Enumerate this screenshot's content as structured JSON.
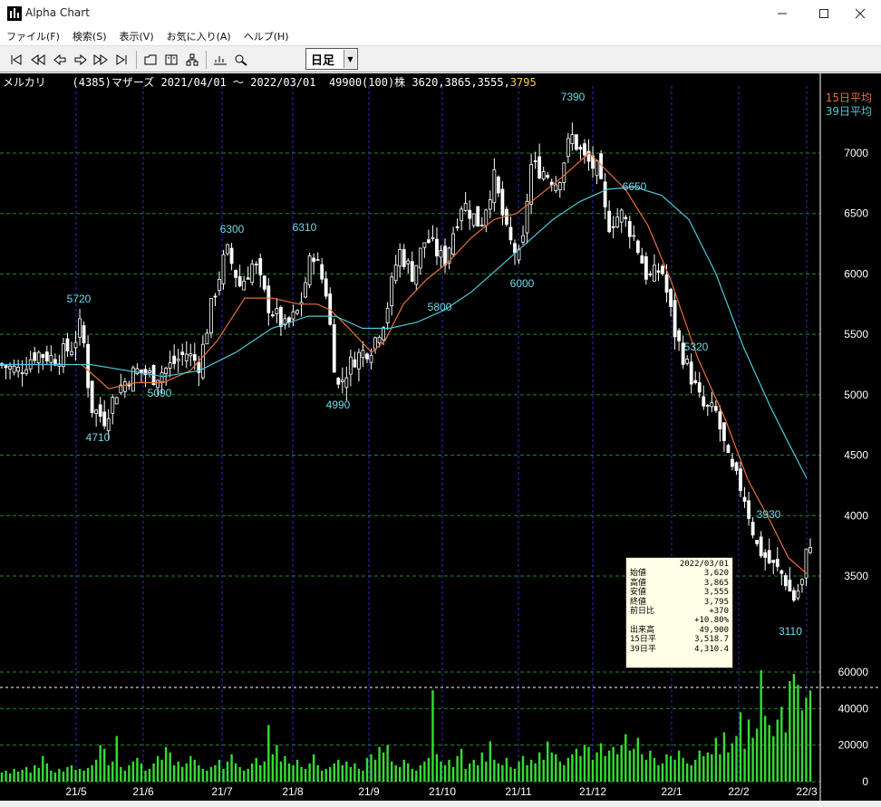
{
  "window": {
    "title": "Alpha Chart"
  },
  "menu": {
    "items": [
      "ファイル(F)",
      "検索(S)",
      "表示(V)",
      "お気に入り(A)",
      "ヘルプ(H)"
    ]
  },
  "toolbar": {
    "period": "日足"
  },
  "header": {
    "name": "メルカリ",
    "code": "(4385)マザーズ",
    "range": "2021/04/01 ～ 2022/03/01",
    "volume": "49900(100)株",
    "ohl": "3620,3865,3555,",
    "close": "3795"
  },
  "legend": {
    "ma15": "15日平均",
    "ma39": "39日平均"
  },
  "info": {
    "date": "2022/03/01",
    "rows": [
      {
        "label": "始値",
        "value": "3,620"
      },
      {
        "label": "高値",
        "value": "3,865"
      },
      {
        "label": "安値",
        "value": "3,555"
      },
      {
        "label": "終値",
        "value": "3,795"
      },
      {
        "label": "前日比",
        "value": "+370"
      },
      {
        "label": "",
        "value": "+10.80%"
      },
      {
        "label": "出来高",
        "value": "49,900"
      },
      {
        "label": "15日平",
        "value": "3,518.7"
      },
      {
        "label": "39日平",
        "value": "4,310.4"
      }
    ]
  },
  "colors": {
    "candle": "#ffffff",
    "ma15": "#e8703a",
    "ma39": "#4fc8d8",
    "volume": "#33dd33",
    "grid_price": "#1f8a1f",
    "grid_month": "#2c2cc8",
    "annotation": "#70d8ea"
  },
  "chart_data": {
    "type": "candlestick",
    "price_axis": {
      "ticks": [
        7000,
        6500,
        6000,
        5500,
        5000,
        4500,
        4000,
        3500
      ],
      "range": [
        3050,
        7500
      ]
    },
    "volume_axis": {
      "ticks": [
        60000,
        40000,
        20000,
        0
      ],
      "range": [
        0,
        60000
      ]
    },
    "x_labels": [
      "21/5",
      "21/6",
      "21/7",
      "21/8",
      "21/9",
      "21/10",
      "21/11",
      "21/12",
      "22/1",
      "22/2",
      "22/3"
    ],
    "annotations": [
      {
        "text": "5720",
        "value": 5720
      },
      {
        "text": "4710",
        "value": 4710
      },
      {
        "text": "5090",
        "value": 5090
      },
      {
        "text": "6300",
        "value": 6300
      },
      {
        "text": "6310",
        "value": 6310
      },
      {
        "text": "4990",
        "value": 4990
      },
      {
        "text": "5800",
        "value": 5800
      },
      {
        "text": "6000",
        "value": 6000
      },
      {
        "text": "7390",
        "value": 7390
      },
      {
        "text": "6650",
        "value": 6650
      },
      {
        "text": "5320",
        "value": 5320
      },
      {
        "text": "3930",
        "value": 3930
      },
      {
        "text": "3110",
        "value": 3110
      }
    ],
    "close_path": [
      [
        0,
        5250
      ],
      [
        20,
        5200
      ],
      [
        40,
        5350
      ],
      [
        60,
        5300
      ],
      [
        80,
        5400
      ],
      [
        90,
        5600
      ],
      [
        100,
        4900
      ],
      [
        115,
        4800
      ],
      [
        130,
        5050
      ],
      [
        150,
        5200
      ],
      [
        170,
        5150
      ],
      [
        190,
        5250
      ],
      [
        205,
        5350
      ],
      [
        220,
        5250
      ],
      [
        235,
        5800
      ],
      [
        250,
        6200
      ],
      [
        265,
        5900
      ],
      [
        280,
        6100
      ],
      [
        295,
        5750
      ],
      [
        315,
        5550
      ],
      [
        330,
        5700
      ],
      [
        345,
        6200
      ],
      [
        360,
        5850
      ],
      [
        372,
        5050
      ],
      [
        390,
        5300
      ],
      [
        410,
        5400
      ],
      [
        425,
        5650
      ],
      [
        440,
        6200
      ],
      [
        455,
        6000
      ],
      [
        470,
        6300
      ],
      [
        490,
        6100
      ],
      [
        510,
        6600
      ],
      [
        530,
        6400
      ],
      [
        545,
        6800
      ],
      [
        560,
        6300
      ],
      [
        575,
        6100
      ],
      [
        585,
        6900
      ],
      [
        600,
        6850
      ],
      [
        615,
        6750
      ],
      [
        630,
        7150
      ],
      [
        645,
        6950
      ],
      [
        660,
        6850
      ],
      [
        670,
        6400
      ],
      [
        685,
        6500
      ],
      [
        700,
        6300
      ],
      [
        715,
        5950
      ],
      [
        730,
        6050
      ],
      [
        745,
        5500
      ],
      [
        760,
        5200
      ],
      [
        775,
        4900
      ],
      [
        790,
        4850
      ],
      [
        805,
        4400
      ],
      [
        820,
        4200
      ],
      [
        835,
        3750
      ],
      [
        850,
        3600
      ],
      [
        865,
        3500
      ],
      [
        875,
        3300
      ],
      [
        885,
        3450
      ],
      [
        892,
        3795
      ]
    ],
    "ma15_path": [
      [
        90,
        5250
      ],
      [
        120,
        5050
      ],
      [
        150,
        5100
      ],
      [
        180,
        5100
      ],
      [
        210,
        5200
      ],
      [
        240,
        5450
      ],
      [
        270,
        5800
      ],
      [
        300,
        5800
      ],
      [
        330,
        5750
      ],
      [
        350,
        5750
      ],
      [
        365,
        5700
      ],
      [
        385,
        5550
      ],
      [
        410,
        5350
      ],
      [
        425,
        5450
      ],
      [
        445,
        5750
      ],
      [
        470,
        5950
      ],
      [
        495,
        6100
      ],
      [
        520,
        6300
      ],
      [
        545,
        6450
      ],
      [
        570,
        6500
      ],
      [
        595,
        6650
      ],
      [
        620,
        6800
      ],
      [
        650,
        7000
      ],
      [
        670,
        6850
      ],
      [
        690,
        6700
      ],
      [
        715,
        6400
      ],
      [
        740,
        5950
      ],
      [
        770,
        5300
      ],
      [
        800,
        4800
      ],
      [
        825,
        4300
      ],
      [
        850,
        3950
      ],
      [
        870,
        3650
      ],
      [
        890,
        3520
      ]
    ],
    "ma39_path": [
      [
        0,
        5250
      ],
      [
        60,
        5250
      ],
      [
        100,
        5250
      ],
      [
        140,
        5200
      ],
      [
        180,
        5150
      ],
      [
        220,
        5200
      ],
      [
        260,
        5350
      ],
      [
        300,
        5550
      ],
      [
        340,
        5650
      ],
      [
        370,
        5650
      ],
      [
        400,
        5550
      ],
      [
        430,
        5550
      ],
      [
        460,
        5600
      ],
      [
        490,
        5700
      ],
      [
        520,
        5850
      ],
      [
        550,
        6050
      ],
      [
        580,
        6250
      ],
      [
        610,
        6450
      ],
      [
        640,
        6600
      ],
      [
        670,
        6700
      ],
      [
        700,
        6720
      ],
      [
        730,
        6650
      ],
      [
        760,
        6450
      ],
      [
        790,
        6000
      ],
      [
        820,
        5400
      ],
      [
        850,
        4900
      ],
      [
        870,
        4600
      ],
      [
        890,
        4310
      ]
    ],
    "volumes": [
      5000,
      6000,
      4500,
      7000,
      5500,
      6500,
      8000,
      5000,
      9000,
      7500,
      14000,
      10000,
      6000,
      5000,
      7000,
      5500,
      8000,
      9000,
      6500,
      7000,
      6000,
      7500,
      9000,
      12000,
      20000,
      18000,
      9000,
      11000,
      25000,
      8000,
      6000,
      9000,
      11000,
      13000,
      10000,
      6000,
      7000,
      10000,
      14000,
      12000,
      19000,
      16000,
      9000,
      11000,
      8000,
      10000,
      14000,
      12000,
      9000,
      7000,
      6000,
      8000,
      9000,
      12000,
      7000,
      11000,
      15000,
      10000,
      8000,
      6000,
      7000,
      10000,
      13000,
      9000,
      11000,
      31000,
      15000,
      20000,
      11000,
      14000,
      10000,
      9000,
      12000,
      8000,
      7000,
      10000,
      15000,
      9000,
      6000,
      7000,
      8000,
      10000,
      12000,
      9000,
      11000,
      8000,
      10000,
      7000,
      6000,
      13000,
      15000,
      12000,
      19000,
      16000,
      20000,
      11000,
      9000,
      8000,
      12000,
      10000,
      7000,
      6000,
      9000,
      11000,
      13000,
      50000,
      15000,
      11000,
      9000,
      12000,
      8000,
      14000,
      18000,
      7000,
      10000,
      12000,
      9000,
      16000,
      11000,
      22000,
      12000,
      10000,
      9000,
      13000,
      8000,
      7000,
      11000,
      14000,
      9000,
      12000,
      10000,
      16000,
      12000,
      22000,
      16000,
      15000,
      11000,
      9000,
      13000,
      15000,
      18000,
      14000,
      20000,
      19000,
      12000,
      16000,
      21000,
      14000,
      17000,
      19000,
      15000,
      20000,
      26000,
      17000,
      18000,
      24000,
      15000,
      12000,
      17000,
      13000,
      9000,
      10000,
      15000,
      14000,
      12000,
      17000,
      13000,
      10000,
      9000,
      12000,
      17000,
      14000,
      16000,
      15000,
      24000,
      15000,
      27000,
      16000,
      21000,
      25000,
      38000,
      18000,
      34000,
      24000,
      29000,
      61000,
      36000,
      31000,
      25000,
      34000,
      41000,
      27000,
      55000,
      59000,
      53000,
      39000,
      46000,
      49900
    ]
  }
}
